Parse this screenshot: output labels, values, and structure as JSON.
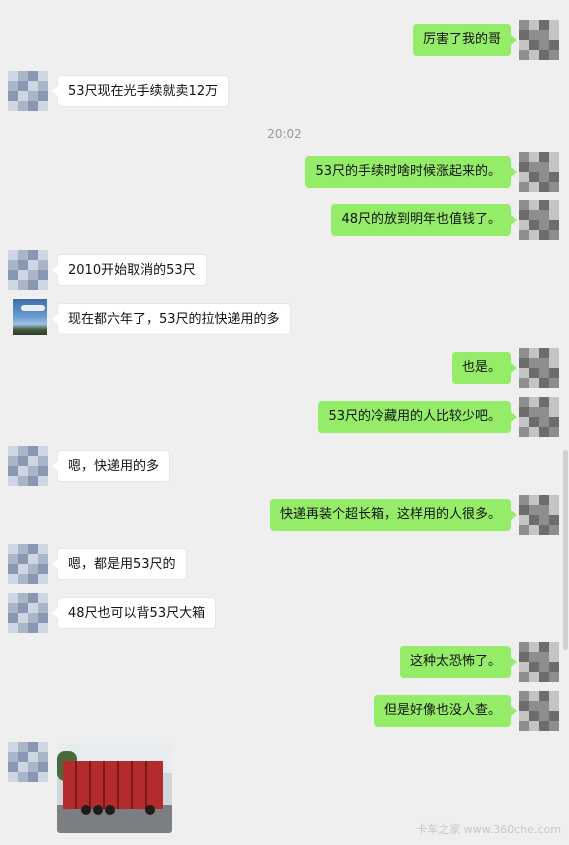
{
  "timestamp": "20:02",
  "messages": [
    {
      "side": "me",
      "text": "厉害了我的哥"
    },
    {
      "side": "them",
      "text": "53尺现在光手续就卖12万"
    },
    {
      "side": "me",
      "text": "53尺的手续时啥时候涨起来的。"
    },
    {
      "side": "me",
      "text": "48尺的放到明年也值钱了。"
    },
    {
      "side": "them",
      "text": "2010开始取消的53尺"
    },
    {
      "side": "them",
      "text": "现在都六年了，53尺的拉快递用的多"
    },
    {
      "side": "me",
      "text": "也是。"
    },
    {
      "side": "me",
      "text": "53尺的冷藏用的人比较少吧。"
    },
    {
      "side": "them",
      "text": "嗯，快递用的多"
    },
    {
      "side": "me",
      "text": "快递再装个超长箱，这样用的人很多。"
    },
    {
      "side": "them",
      "text": "嗯，都是用53尺的"
    },
    {
      "side": "them",
      "text": "48尺也可以背53尺大箱"
    },
    {
      "side": "me",
      "text": "这种太恐怖了。"
    },
    {
      "side": "me",
      "text": "但是好像也没人查。"
    }
  ],
  "watermark": "卡车之家 www.360che.com",
  "colors": {
    "my_bubble": "#95ec69",
    "their_bubble": "#ffffff",
    "background": "#efefef"
  }
}
